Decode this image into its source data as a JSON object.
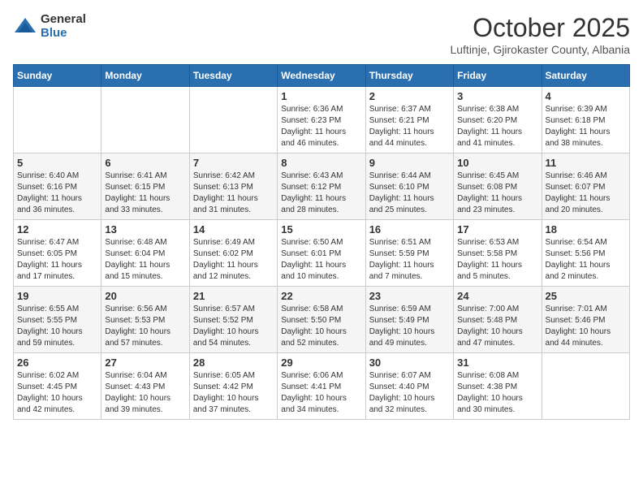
{
  "header": {
    "logo_general": "General",
    "logo_blue": "Blue",
    "month_title": "October 2025",
    "subtitle": "Luftinje, Gjirokaster County, Albania"
  },
  "calendar": {
    "days_of_week": [
      "Sunday",
      "Monday",
      "Tuesday",
      "Wednesday",
      "Thursday",
      "Friday",
      "Saturday"
    ],
    "weeks": [
      [
        {
          "day": "",
          "info": ""
        },
        {
          "day": "",
          "info": ""
        },
        {
          "day": "",
          "info": ""
        },
        {
          "day": "1",
          "info": "Sunrise: 6:36 AM\nSunset: 6:23 PM\nDaylight: 11 hours\nand 46 minutes."
        },
        {
          "day": "2",
          "info": "Sunrise: 6:37 AM\nSunset: 6:21 PM\nDaylight: 11 hours\nand 44 minutes."
        },
        {
          "day": "3",
          "info": "Sunrise: 6:38 AM\nSunset: 6:20 PM\nDaylight: 11 hours\nand 41 minutes."
        },
        {
          "day": "4",
          "info": "Sunrise: 6:39 AM\nSunset: 6:18 PM\nDaylight: 11 hours\nand 38 minutes."
        }
      ],
      [
        {
          "day": "5",
          "info": "Sunrise: 6:40 AM\nSunset: 6:16 PM\nDaylight: 11 hours\nand 36 minutes."
        },
        {
          "day": "6",
          "info": "Sunrise: 6:41 AM\nSunset: 6:15 PM\nDaylight: 11 hours\nand 33 minutes."
        },
        {
          "day": "7",
          "info": "Sunrise: 6:42 AM\nSunset: 6:13 PM\nDaylight: 11 hours\nand 31 minutes."
        },
        {
          "day": "8",
          "info": "Sunrise: 6:43 AM\nSunset: 6:12 PM\nDaylight: 11 hours\nand 28 minutes."
        },
        {
          "day": "9",
          "info": "Sunrise: 6:44 AM\nSunset: 6:10 PM\nDaylight: 11 hours\nand 25 minutes."
        },
        {
          "day": "10",
          "info": "Sunrise: 6:45 AM\nSunset: 6:08 PM\nDaylight: 11 hours\nand 23 minutes."
        },
        {
          "day": "11",
          "info": "Sunrise: 6:46 AM\nSunset: 6:07 PM\nDaylight: 11 hours\nand 20 minutes."
        }
      ],
      [
        {
          "day": "12",
          "info": "Sunrise: 6:47 AM\nSunset: 6:05 PM\nDaylight: 11 hours\nand 17 minutes."
        },
        {
          "day": "13",
          "info": "Sunrise: 6:48 AM\nSunset: 6:04 PM\nDaylight: 11 hours\nand 15 minutes."
        },
        {
          "day": "14",
          "info": "Sunrise: 6:49 AM\nSunset: 6:02 PM\nDaylight: 11 hours\nand 12 minutes."
        },
        {
          "day": "15",
          "info": "Sunrise: 6:50 AM\nSunset: 6:01 PM\nDaylight: 11 hours\nand 10 minutes."
        },
        {
          "day": "16",
          "info": "Sunrise: 6:51 AM\nSunset: 5:59 PM\nDaylight: 11 hours\nand 7 minutes."
        },
        {
          "day": "17",
          "info": "Sunrise: 6:53 AM\nSunset: 5:58 PM\nDaylight: 11 hours\nand 5 minutes."
        },
        {
          "day": "18",
          "info": "Sunrise: 6:54 AM\nSunset: 5:56 PM\nDaylight: 11 hours\nand 2 minutes."
        }
      ],
      [
        {
          "day": "19",
          "info": "Sunrise: 6:55 AM\nSunset: 5:55 PM\nDaylight: 10 hours\nand 59 minutes."
        },
        {
          "day": "20",
          "info": "Sunrise: 6:56 AM\nSunset: 5:53 PM\nDaylight: 10 hours\nand 57 minutes."
        },
        {
          "day": "21",
          "info": "Sunrise: 6:57 AM\nSunset: 5:52 PM\nDaylight: 10 hours\nand 54 minutes."
        },
        {
          "day": "22",
          "info": "Sunrise: 6:58 AM\nSunset: 5:50 PM\nDaylight: 10 hours\nand 52 minutes."
        },
        {
          "day": "23",
          "info": "Sunrise: 6:59 AM\nSunset: 5:49 PM\nDaylight: 10 hours\nand 49 minutes."
        },
        {
          "day": "24",
          "info": "Sunrise: 7:00 AM\nSunset: 5:48 PM\nDaylight: 10 hours\nand 47 minutes."
        },
        {
          "day": "25",
          "info": "Sunrise: 7:01 AM\nSunset: 5:46 PM\nDaylight: 10 hours\nand 44 minutes."
        }
      ],
      [
        {
          "day": "26",
          "info": "Sunrise: 6:02 AM\nSunset: 4:45 PM\nDaylight: 10 hours\nand 42 minutes."
        },
        {
          "day": "27",
          "info": "Sunrise: 6:04 AM\nSunset: 4:43 PM\nDaylight: 10 hours\nand 39 minutes."
        },
        {
          "day": "28",
          "info": "Sunrise: 6:05 AM\nSunset: 4:42 PM\nDaylight: 10 hours\nand 37 minutes."
        },
        {
          "day": "29",
          "info": "Sunrise: 6:06 AM\nSunset: 4:41 PM\nDaylight: 10 hours\nand 34 minutes."
        },
        {
          "day": "30",
          "info": "Sunrise: 6:07 AM\nSunset: 4:40 PM\nDaylight: 10 hours\nand 32 minutes."
        },
        {
          "day": "31",
          "info": "Sunrise: 6:08 AM\nSunset: 4:38 PM\nDaylight: 10 hours\nand 30 minutes."
        },
        {
          "day": "",
          "info": ""
        }
      ]
    ]
  }
}
